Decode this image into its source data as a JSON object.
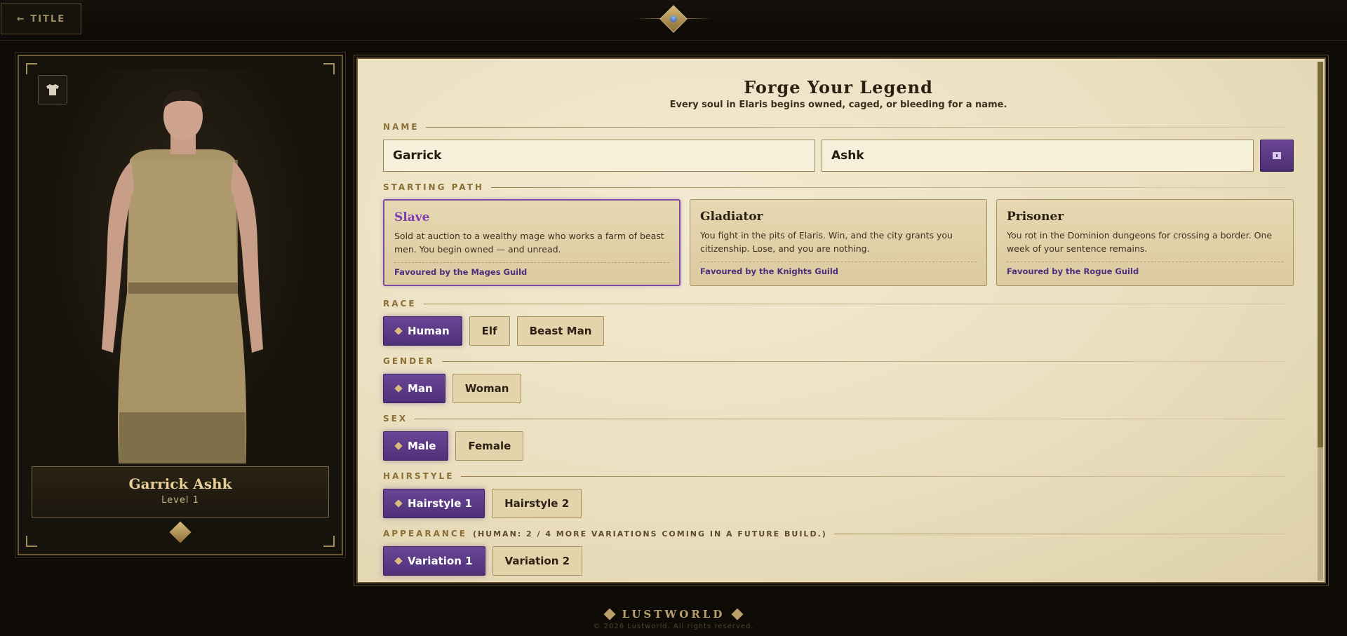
{
  "topbar": {
    "back_label": "← TITLE"
  },
  "character": {
    "full_name": "Garrick Ashk",
    "level_label": "Level 1"
  },
  "form": {
    "title": "Forge Your Legend",
    "subtitle": "Every soul in Elaris begins owned, caged, or bleeding for a name.",
    "name_label": "NAME",
    "first_name": "Garrick",
    "last_name": "Ashk",
    "path_label": "STARTING PATH",
    "paths": [
      {
        "title": "Slave",
        "desc": "Sold at auction to a wealthy mage who works a farm of beast men. You begin owned — and unread.",
        "favour": "Favoured by the Mages Guild",
        "selected": true
      },
      {
        "title": "Gladiator",
        "desc": "You fight in the pits of Elaris. Win, and the city grants you citizenship. Lose, and you are nothing.",
        "favour": "Favoured by the Knights Guild",
        "selected": false
      },
      {
        "title": "Prisoner",
        "desc": "You rot in the Dominion dungeons for crossing a border. One week of your sentence remains.",
        "favour": "Favoured by the Rogue Guild",
        "selected": false
      }
    ],
    "race_label": "RACE",
    "races": [
      "Human",
      "Elf",
      "Beast Man"
    ],
    "gender_label": "GENDER",
    "genders": [
      "Man",
      "Woman"
    ],
    "sex_label": "SEX",
    "sexes": [
      "Male",
      "Female"
    ],
    "hair_label": "HAIRSTYLE",
    "hairstyles": [
      "Hairstyle 1",
      "Hairstyle 2"
    ],
    "appearance_label": "APPEARANCE",
    "appearance_note": "(HUMAN: 2 / 4 MORE VARIATIONS COMING IN A FUTURE BUILD.)",
    "variations": [
      "Variation 1",
      "Variation 2"
    ]
  },
  "footer": {
    "brand": "LUSTWORLD",
    "copyright": "© 2026 Lustworld. All rights reserved."
  },
  "colors": {
    "accent": "#5b3a85",
    "gold": "#b9a06b",
    "parchment": "#efe5c9"
  }
}
